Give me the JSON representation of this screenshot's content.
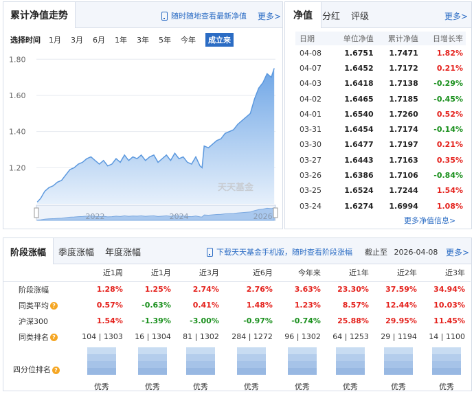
{
  "left_panel": {
    "title": "累计净值走势",
    "notice": "随时随地查看最新净值",
    "more": "更多>",
    "period_label": "选择时间",
    "periods": [
      "1月",
      "3月",
      "6月",
      "1年",
      "3年",
      "5年",
      "今年",
      "成立来"
    ],
    "watermark": "天天基金"
  },
  "chart_data": {
    "type": "area",
    "y_ticks": [
      "1.80",
      "1.60",
      "1.40",
      "1.20"
    ],
    "ylim": [
      1.0,
      1.82
    ],
    "x_ticks": [
      "2022",
      "2024",
      "2026"
    ],
    "xlim": [
      2020.6,
      2026.3
    ],
    "grid": true,
    "series": [
      {
        "x": [
          2020.62,
          2020.7,
          2020.8,
          2020.9,
          2021.0,
          2021.1,
          2021.2,
          2021.3,
          2021.4,
          2021.5,
          2021.6,
          2021.7,
          2021.8,
          2021.9,
          2022.0,
          2022.1,
          2022.2,
          2022.3,
          2022.4,
          2022.5,
          2022.6,
          2022.7,
          2022.8,
          2022.9,
          2023.0,
          2023.1,
          2023.2,
          2023.3,
          2023.4,
          2023.5,
          2023.6,
          2023.7,
          2023.8,
          2023.9,
          2024.0,
          2024.1,
          2024.2,
          2024.3,
          2024.4,
          2024.5,
          2024.55,
          2024.6,
          2024.7,
          2024.8,
          2024.9,
          2025.0,
          2025.1,
          2025.2,
          2025.3,
          2025.4,
          2025.5,
          2025.6,
          2025.7,
          2025.8,
          2025.9,
          2026.0,
          2026.1,
          2026.2,
          2026.27
        ],
        "y": [
          1.01,
          1.03,
          1.07,
          1.09,
          1.1,
          1.12,
          1.13,
          1.16,
          1.19,
          1.2,
          1.22,
          1.23,
          1.25,
          1.26,
          1.24,
          1.22,
          1.24,
          1.21,
          1.22,
          1.25,
          1.23,
          1.27,
          1.24,
          1.26,
          1.25,
          1.27,
          1.24,
          1.26,
          1.27,
          1.23,
          1.25,
          1.27,
          1.24,
          1.28,
          1.25,
          1.26,
          1.23,
          1.22,
          1.26,
          1.21,
          1.2,
          1.32,
          1.31,
          1.33,
          1.35,
          1.36,
          1.39,
          1.4,
          1.41,
          1.44,
          1.46,
          1.48,
          1.5,
          1.58,
          1.64,
          1.67,
          1.72,
          1.7,
          1.75
        ]
      }
    ]
  },
  "right_panel": {
    "tabs": [
      "净值",
      "分红",
      "评级"
    ],
    "more": "更多>",
    "columns": [
      "日期",
      "单位净值",
      "累计净值",
      "日增长率"
    ],
    "rows": [
      {
        "date": "04-08",
        "unit": "1.6751",
        "acc": "1.7471",
        "chg": "1.82%",
        "dir": "up"
      },
      {
        "date": "04-07",
        "unit": "1.6452",
        "acc": "1.7172",
        "chg": "0.21%",
        "dir": "up"
      },
      {
        "date": "04-03",
        "unit": "1.6418",
        "acc": "1.7138",
        "chg": "-0.29%",
        "dir": "dn"
      },
      {
        "date": "04-02",
        "unit": "1.6465",
        "acc": "1.7185",
        "chg": "-0.45%",
        "dir": "dn"
      },
      {
        "date": "04-01",
        "unit": "1.6540",
        "acc": "1.7260",
        "chg": "0.52%",
        "dir": "up"
      },
      {
        "date": "03-31",
        "unit": "1.6454",
        "acc": "1.7174",
        "chg": "-0.14%",
        "dir": "dn"
      },
      {
        "date": "03-30",
        "unit": "1.6477",
        "acc": "1.7197",
        "chg": "0.21%",
        "dir": "up"
      },
      {
        "date": "03-27",
        "unit": "1.6443",
        "acc": "1.7163",
        "chg": "0.35%",
        "dir": "up"
      },
      {
        "date": "03-26",
        "unit": "1.6386",
        "acc": "1.7106",
        "chg": "-0.84%",
        "dir": "dn"
      },
      {
        "date": "03-25",
        "unit": "1.6524",
        "acc": "1.7244",
        "chg": "1.54%",
        "dir": "up"
      },
      {
        "date": "03-24",
        "unit": "1.6274",
        "acc": "1.6994",
        "chg": "1.08%",
        "dir": "up"
      }
    ],
    "footer_link": "更多净值信息>"
  },
  "bottom_panel": {
    "tabs": [
      "阶段涨幅",
      "季度涨幅",
      "年度涨幅"
    ],
    "notice": "下载天天基金手机版，随时查看阶段涨幅",
    "as_of_label": "截止至",
    "as_of_date": "2026-04-08",
    "more": "更多>",
    "columns": [
      "近1周",
      "近1月",
      "近3月",
      "近6月",
      "今年来",
      "近1年",
      "近2年",
      "近3年"
    ],
    "rows": [
      {
        "label": "阶段涨幅",
        "help": false,
        "values": [
          {
            "v": "1.28%",
            "dir": "up"
          },
          {
            "v": "1.25%",
            "dir": "up"
          },
          {
            "v": "2.74%",
            "dir": "up"
          },
          {
            "v": "2.76%",
            "dir": "up"
          },
          {
            "v": "3.63%",
            "dir": "up"
          },
          {
            "v": "23.30%",
            "dir": "up"
          },
          {
            "v": "37.59%",
            "dir": "up"
          },
          {
            "v": "34.94%",
            "dir": "up"
          }
        ]
      },
      {
        "label": "同类平均",
        "help": true,
        "values": [
          {
            "v": "0.57%",
            "dir": "up"
          },
          {
            "v": "-0.63%",
            "dir": "dn"
          },
          {
            "v": "0.41%",
            "dir": "up"
          },
          {
            "v": "1.48%",
            "dir": "up"
          },
          {
            "v": "1.23%",
            "dir": "up"
          },
          {
            "v": "8.57%",
            "dir": "up"
          },
          {
            "v": "12.44%",
            "dir": "up"
          },
          {
            "v": "10.03%",
            "dir": "up"
          }
        ]
      },
      {
        "label": "沪深300",
        "help": false,
        "values": [
          {
            "v": "1.54%",
            "dir": "up"
          },
          {
            "v": "-1.39%",
            "dir": "dn"
          },
          {
            "v": "-3.00%",
            "dir": "dn"
          },
          {
            "v": "-0.97%",
            "dir": "dn"
          },
          {
            "v": "-0.74%",
            "dir": "dn"
          },
          {
            "v": "25.88%",
            "dir": "up"
          },
          {
            "v": "29.95%",
            "dir": "up"
          },
          {
            "v": "11.45%",
            "dir": "up"
          }
        ]
      },
      {
        "label": "同类排名",
        "help": true,
        "values": [
          {
            "v": "104 | 1303",
            "dir": ""
          },
          {
            "v": "16 | 1304",
            "dir": ""
          },
          {
            "v": "81 | 1302",
            "dir": ""
          },
          {
            "v": "284 | 1272",
            "dir": ""
          },
          {
            "v": "96 | 1302",
            "dir": ""
          },
          {
            "v": "64 | 1253",
            "dir": ""
          },
          {
            "v": "29 | 1194",
            "dir": ""
          },
          {
            "v": "14 | 1100",
            "dir": ""
          }
        ]
      }
    ],
    "quartile_label": "四分位排名",
    "quartile_values": [
      "优秀",
      "优秀",
      "优秀",
      "优秀",
      "优秀",
      "优秀",
      "优秀",
      "优秀"
    ],
    "quartile_level": 4,
    "colors": {
      "up": "#e4211c",
      "down": "#198f1c",
      "accent": "#2b6cc4"
    }
  }
}
